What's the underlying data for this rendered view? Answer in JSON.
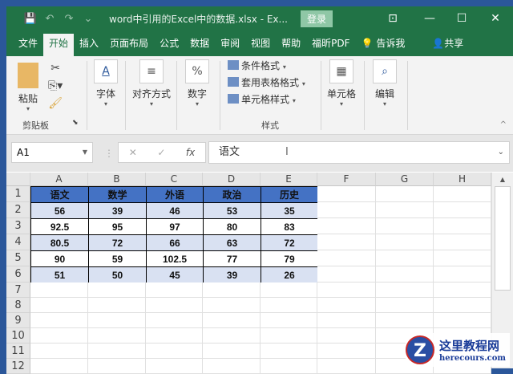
{
  "titlebar": {
    "title": "word中引用的Excel中的数据.xlsx  -  Ex...",
    "login": "登录"
  },
  "tabs": [
    "文件",
    "开始",
    "插入",
    "页面布局",
    "公式",
    "数据",
    "审阅",
    "视图",
    "帮助",
    "福昕PDF",
    "告诉我",
    "共享"
  ],
  "ribbon": {
    "paste": "粘贴",
    "clipboard": "剪贴板",
    "font": "字体",
    "align": "对齐方式",
    "number": "数字",
    "cond": "条件格式",
    "table_fmt": "套用表格格式",
    "cell_style": "单元格样式",
    "styles": "样式",
    "cells": "单元格",
    "edit": "编辑"
  },
  "formula": {
    "namebox": "A1",
    "content": "语文"
  },
  "columns": [
    "A",
    "B",
    "C",
    "D",
    "E",
    "F",
    "G",
    "H"
  ],
  "rows": [
    "1",
    "2",
    "3",
    "4",
    "5",
    "6",
    "7",
    "8",
    "9",
    "10",
    "11",
    "12"
  ],
  "table": [
    [
      "语文",
      "数学",
      "外语",
      "政治",
      "历史"
    ],
    [
      "56",
      "39",
      "46",
      "53",
      "35"
    ],
    [
      "92.5",
      "95",
      "97",
      "80",
      "83"
    ],
    [
      "80.5",
      "72",
      "66",
      "63",
      "72"
    ],
    [
      "90",
      "59",
      "102.5",
      "77",
      "79"
    ],
    [
      "51",
      "50",
      "45",
      "39",
      "26"
    ]
  ],
  "colors": {
    "header": "#4472c4",
    "band": "#d9e1f2",
    "green": "#217346"
  },
  "watermark": {
    "name": "这里教程网",
    "url": "herecours.com"
  }
}
